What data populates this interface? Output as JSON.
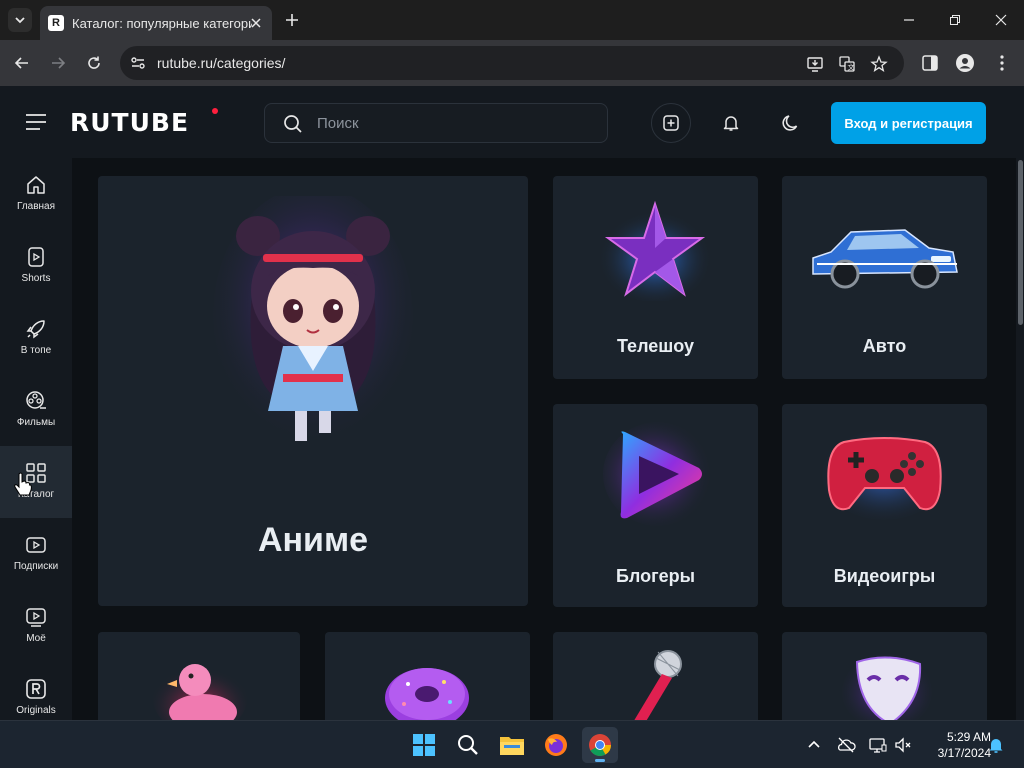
{
  "browser": {
    "tab_title": "Каталог: популярные категории",
    "favicon_letter": "R",
    "url": "rutube.ru/categories/"
  },
  "site": {
    "logo": "RUTUBE",
    "search_placeholder": "Поиск",
    "login_button": "Вход и регистрация",
    "accent_color": "#00a1e7",
    "logo_dot_color": "#ff1f3d"
  },
  "sidebar": {
    "items": [
      {
        "label": "Главная",
        "icon": "home-icon"
      },
      {
        "label": "Shorts",
        "icon": "shorts-icon"
      },
      {
        "label": "В топе",
        "icon": "rocket-icon"
      },
      {
        "label": "Фильмы",
        "icon": "film-reel-icon"
      },
      {
        "label": "Каталог",
        "icon": "grid-icon",
        "active": true
      },
      {
        "label": "Подписки",
        "icon": "subscriptions-icon"
      },
      {
        "label": "Моё",
        "icon": "my-videos-icon"
      },
      {
        "label": "Originals",
        "icon": "originals-icon"
      }
    ]
  },
  "categories": [
    {
      "label": "Аниме",
      "image": "anime-girl-image"
    },
    {
      "label": "Телешоу",
      "image": "star-image"
    },
    {
      "label": "Авто",
      "image": "car-image"
    },
    {
      "label": "Блогеры",
      "image": "play-button-image"
    },
    {
      "label": "Видеоигры",
      "image": "gamepad-image"
    },
    {
      "label": "",
      "image": "rubber-duck-image"
    },
    {
      "label": "",
      "image": "donut-image"
    },
    {
      "label": "",
      "image": "microphone-image"
    },
    {
      "label": "",
      "image": "theater-mask-image"
    }
  ],
  "taskbar": {
    "time": "5:29 AM",
    "date": "3/17/2024"
  }
}
